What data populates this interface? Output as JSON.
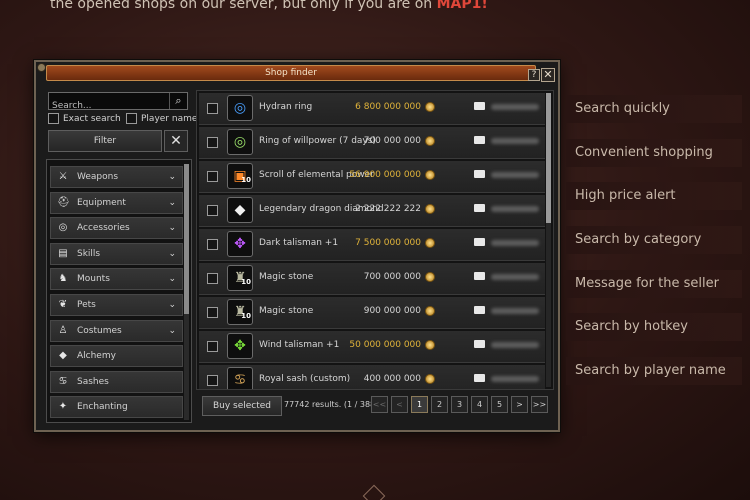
{
  "intro": {
    "line1": "the opened shops on our server, but only if you are on",
    "highlight": "MAP1!",
    "colors": {
      "highlight": "#e0473a"
    }
  },
  "window": {
    "title": "Shop finder",
    "help_label": "?",
    "close_label": "✕"
  },
  "search": {
    "placeholder": "Search...",
    "icon": "search-icon",
    "exact_label": "Exact search",
    "player_label": "Player name",
    "filter_label": "Filter",
    "clear_label": "✕"
  },
  "categories": [
    {
      "label": "Weapons",
      "icon": "sword-icon",
      "glyph": "⚔",
      "expandable": true
    },
    {
      "label": "Equipment",
      "icon": "helmet-icon",
      "glyph": "⛑",
      "expandable": true
    },
    {
      "label": "Accessories",
      "icon": "ring-icon",
      "glyph": "◎",
      "expandable": true
    },
    {
      "label": "Skills",
      "icon": "book-icon",
      "glyph": "▤",
      "expandable": true
    },
    {
      "label": "Mounts",
      "icon": "horse-icon",
      "glyph": "♞",
      "expandable": true
    },
    {
      "label": "Pets",
      "icon": "paw-icon",
      "glyph": "❦",
      "expandable": true
    },
    {
      "label": "Costumes",
      "icon": "shirt-icon",
      "glyph": "♙",
      "expandable": true
    },
    {
      "label": "Alchemy",
      "icon": "gem-icon",
      "glyph": "◆",
      "expandable": false
    },
    {
      "label": "Sashes",
      "icon": "sash-icon",
      "glyph": "♋",
      "expandable": false
    },
    {
      "label": "Enchanting",
      "icon": "sparkle-icon",
      "glyph": "✦",
      "expandable": false
    }
  ],
  "items": [
    {
      "name": "Hydran ring",
      "price": "6 800 000 000",
      "price_color": "#e0b33a",
      "icon": "ring-icon",
      "glyph": "◎",
      "icon_color": "#4aa0ff",
      "count": ""
    },
    {
      "name": "Ring of willpower (7 days)",
      "price": "700 000 000",
      "price_color": "#d6d6d6",
      "icon": "ring-icon",
      "glyph": "◎",
      "icon_color": "#9adf6a",
      "count": ""
    },
    {
      "name": "Scroll of elemental power",
      "price": "56 900 000 000",
      "price_color": "#e0b33a",
      "icon": "scroll-icon",
      "glyph": "▣",
      "icon_color": "#ff8a2a",
      "count": "10"
    },
    {
      "name": "Legendary dragon diamond",
      "price": "2 222 222 222",
      "price_color": "#d6d6d6",
      "icon": "diamond-icon",
      "glyph": "◆",
      "icon_color": "#f0f0f0",
      "count": ""
    },
    {
      "name": "Dark talisman +1",
      "price": "7 500 000 000",
      "price_color": "#e0b33a",
      "icon": "talisman-icon",
      "glyph": "✥",
      "icon_color": "#c05aff",
      "count": ""
    },
    {
      "name": "Magic stone",
      "price": "700 000 000",
      "price_color": "#d6d6d6",
      "icon": "stone-icon",
      "glyph": "♜",
      "icon_color": "#b9b9a0",
      "count": "10"
    },
    {
      "name": "Magic stone",
      "price": "900 000 000",
      "price_color": "#d6d6d6",
      "icon": "stone-icon",
      "glyph": "♜",
      "icon_color": "#b9b9a0",
      "count": "10"
    },
    {
      "name": "Wind talisman +1",
      "price": "50 000 000 000",
      "price_color": "#e0b33a",
      "icon": "talisman-icon",
      "glyph": "✥",
      "icon_color": "#7adf3a",
      "count": ""
    },
    {
      "name": "Royal sash (custom)",
      "price": "400 000 000",
      "price_color": "#d6d6d6",
      "icon": "sash-icon",
      "glyph": "♋",
      "icon_color": "#d9a85a",
      "count": ""
    }
  ],
  "footer": {
    "buy_label": "Buy selected",
    "results": "77742 results. (1 / 3888)",
    "pages": [
      "<<",
      "<",
      "1",
      "2",
      "3",
      "4",
      "5",
      ">",
      ">>"
    ],
    "active_page": "1"
  },
  "features": [
    "Search quickly",
    "Convenient shopping",
    "High price alert",
    "Search by category",
    "Message for the seller",
    "Search by hotkey",
    "Search by player name"
  ]
}
